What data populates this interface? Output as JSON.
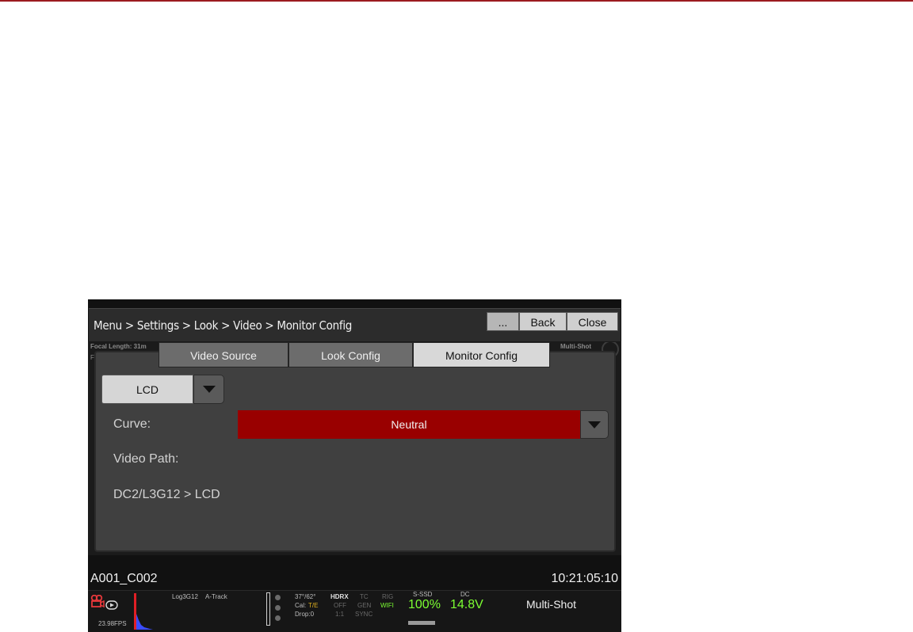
{
  "header": {
    "breadcrumb": "Menu > Settings > Look > Video > Monitor Config",
    "buttons": {
      "more": "...",
      "back": "Back",
      "close": "Close"
    }
  },
  "background": {
    "focal_length": "Focal Length: 31m",
    "left_partial": "F",
    "mode": "Multi-Shot"
  },
  "tabs": [
    {
      "label": "Video Source"
    },
    {
      "label": "Look Config"
    },
    {
      "label": "Monitor Config"
    }
  ],
  "selected_tab": "Monitor Config",
  "monitor": {
    "device": "LCD",
    "curve_label": "Curve:",
    "curve_value": "Neutral",
    "video_path_label": "Video Path:",
    "video_path_value": "DC2/L3G12 > LCD"
  },
  "clip": {
    "name": "A001_C002",
    "timecode": "10:21:05:10"
  },
  "status": {
    "fps": "23.98FPS",
    "look": "Log3G12",
    "track": "A-Track",
    "temp": "37°/62°",
    "cal": "Cal:",
    "cal_value": "T/E",
    "drop": "Drop:0",
    "hdrx": "HDRX",
    "hdrx_value": "OFF",
    "hdrx_ratio": "1:1",
    "tc": "TC",
    "tc_value": "GEN",
    "tc_sync": "SYNC",
    "rig": "RIG",
    "wifi": "WIFI",
    "media": "S-SSD",
    "media_pct": "100%",
    "power": "DC",
    "voltage": "14.8V",
    "mode": "Multi-Shot"
  },
  "colors": {
    "accent_red": "#990000",
    "rule_red": "#9b1b1f",
    "status_green": "#7cff32"
  }
}
